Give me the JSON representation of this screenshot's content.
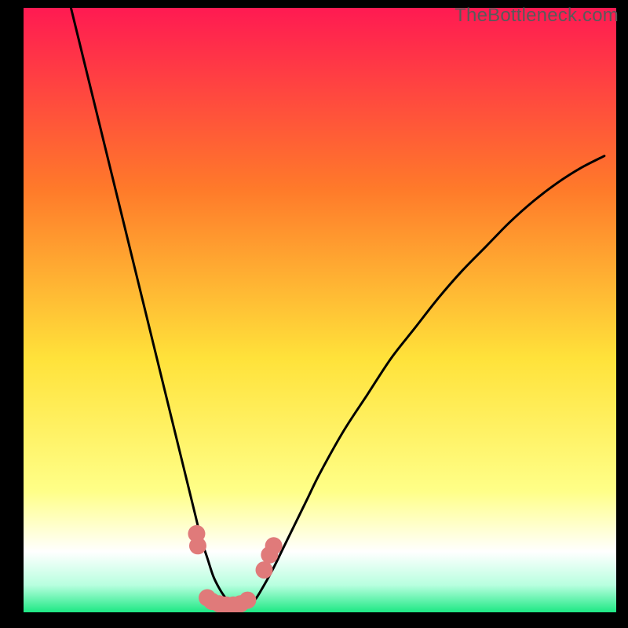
{
  "watermark": "TheBottleneck.com",
  "colors": {
    "frame": "#000000",
    "gradient_top": "#ff1a52",
    "gradient_mid1": "#ff7a2a",
    "gradient_mid2": "#ffe23a",
    "gradient_low": "#ffff88",
    "gradient_white": "#ffffff",
    "gradient_green": "#1ee884",
    "curve": "#000000",
    "dots": "#e07a7a"
  },
  "chart_data": {
    "type": "line",
    "title": "",
    "xlabel": "",
    "ylabel": "",
    "xlim": [
      0,
      100
    ],
    "ylim": [
      0,
      100
    ],
    "series": [
      {
        "name": "bottleneck-curve",
        "x": [
          8,
          10,
          12,
          14,
          16,
          18,
          20,
          22,
          24,
          26,
          27,
          28,
          29,
          30,
          31,
          32,
          33,
          34,
          35,
          36,
          37,
          38,
          39,
          40,
          42,
          44,
          46,
          48,
          50,
          54,
          58,
          62,
          66,
          70,
          74,
          78,
          82,
          86,
          90,
          94,
          98
        ],
        "y": [
          100,
          92,
          84,
          76,
          68,
          60,
          52,
          44,
          36,
          28,
          24,
          20,
          16,
          12,
          9,
          6,
          4,
          2.5,
          1.5,
          1,
          1,
          1.2,
          2,
          3.5,
          7,
          11,
          15,
          19,
          23,
          30,
          36,
          42,
          47,
          52,
          56.5,
          60.5,
          64.5,
          68,
          71,
          73.5,
          75.5
        ]
      }
    ],
    "points": [
      {
        "x": 29.2,
        "y": 13.0
      },
      {
        "x": 29.4,
        "y": 11.0
      },
      {
        "x": 31.0,
        "y": 2.4
      },
      {
        "x": 31.8,
        "y": 1.8
      },
      {
        "x": 33.0,
        "y": 1.4
      },
      {
        "x": 34.2,
        "y": 1.2
      },
      {
        "x": 35.4,
        "y": 1.2
      },
      {
        "x": 36.6,
        "y": 1.4
      },
      {
        "x": 37.8,
        "y": 2.0
      },
      {
        "x": 40.6,
        "y": 7.0
      },
      {
        "x": 41.5,
        "y": 9.5
      },
      {
        "x": 42.2,
        "y": 11.0
      }
    ],
    "gradient_stops": [
      {
        "pos": 0.0,
        "color": "#ff1a52"
      },
      {
        "pos": 0.3,
        "color": "#ff7a2a"
      },
      {
        "pos": 0.58,
        "color": "#ffe23a"
      },
      {
        "pos": 0.8,
        "color": "#ffff88"
      },
      {
        "pos": 0.9,
        "color": "#ffffff"
      },
      {
        "pos": 0.955,
        "color": "#b8ffdf"
      },
      {
        "pos": 1.0,
        "color": "#1ee884"
      }
    ]
  }
}
